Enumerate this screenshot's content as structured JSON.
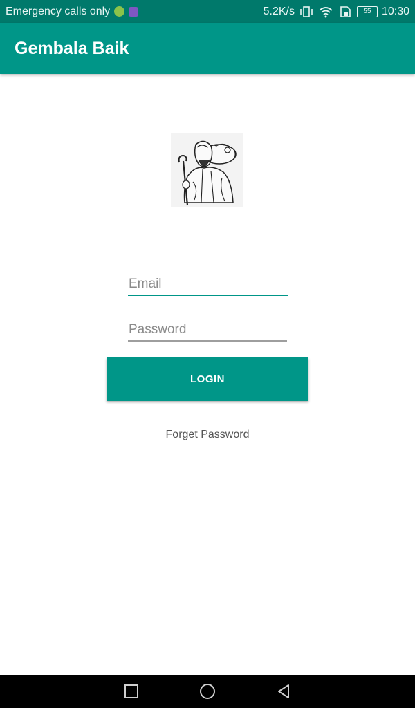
{
  "status_bar": {
    "carrier_text": "Emergency calls only",
    "speed": "5.2K/s",
    "battery": "55",
    "time": "10:30",
    "icons": [
      "notification-green-dot",
      "gallery-icon",
      "vibrate-icon",
      "wifi-icon",
      "sim-icon",
      "battery-icon"
    ]
  },
  "app_bar": {
    "title": "Gembala Baik",
    "color": "#009688"
  },
  "login_form": {
    "email_placeholder": "Email",
    "email_value": "",
    "password_placeholder": "Password",
    "password_value": "",
    "login_label": "LOGIN",
    "forget_label": "Forget Password"
  },
  "nav_bar": {
    "buttons": [
      "recents-square-icon",
      "home-circle-icon",
      "back-triangle-icon"
    ]
  },
  "colors": {
    "accent": "#009688",
    "status_bar": "#00796b"
  }
}
